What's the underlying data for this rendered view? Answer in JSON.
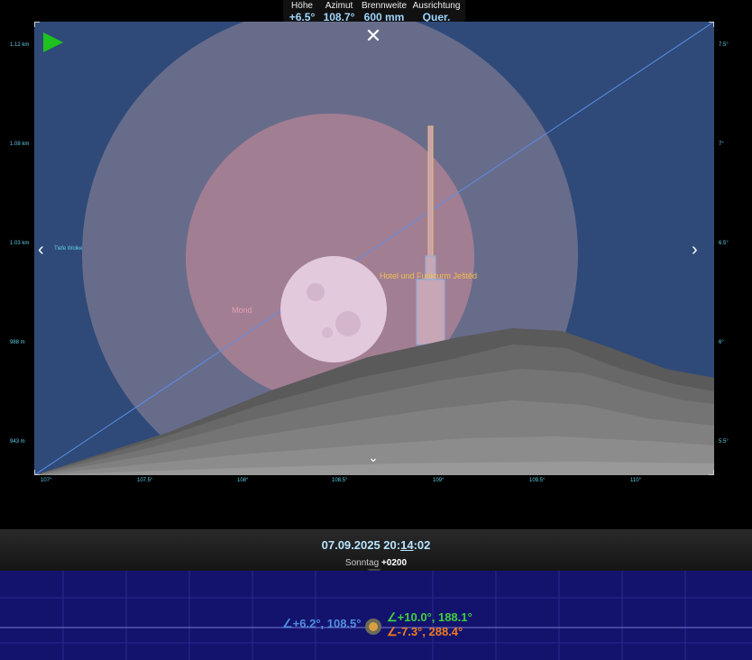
{
  "readout": {
    "altitude_label": "Höhe",
    "altitude_value": "+6.5°",
    "azimuth_label": "Azimut",
    "azimuth_value": "108.7°",
    "focal_label": "Brennweite",
    "focal_value": "600 mm",
    "orientation_label": "Ausrichtung",
    "orientation_value": "Quer."
  },
  "axes": {
    "left": [
      "1.12 km",
      "1.08 km",
      "1.03 km",
      "988 m",
      "943 m"
    ],
    "right": [
      "7.5°",
      "7°",
      "6.5°",
      "6°",
      "5.5°"
    ],
    "bottom": [
      "107°",
      "107.5°",
      "108°",
      "108.5°",
      "109°",
      "109.5°",
      "110°"
    ]
  },
  "scene": {
    "moon_label": "Mond",
    "tower_label": "Hotel und Funkturm Ještěd",
    "cloud_label": "Tiefe Wolke",
    "moon_color": "#e8c8dc",
    "halo_color": "#c98a9a",
    "tower_label_color": "#f0c050",
    "sky_color": "#2f4a78"
  },
  "controls": {
    "close_glyph": "✕",
    "prev_glyph": "‹",
    "next_glyph": "›",
    "down_glyph": "⌄"
  },
  "time": {
    "date": "07.09.2025 20:",
    "minute": "14",
    "seconds": ":02",
    "weekday": "Sonntag",
    "tz": "+0200"
  },
  "timeline": {
    "moon_reading": "∠+6.2°, 108.5°",
    "sun_top_reading": "∠+10.0°, 188.1°",
    "sun_bottom_reading": "∠-7.3°, 288.4°",
    "moon_color": "#4f8fe0",
    "green_color": "#3fcf3f",
    "orange_color": "#f07a20"
  }
}
